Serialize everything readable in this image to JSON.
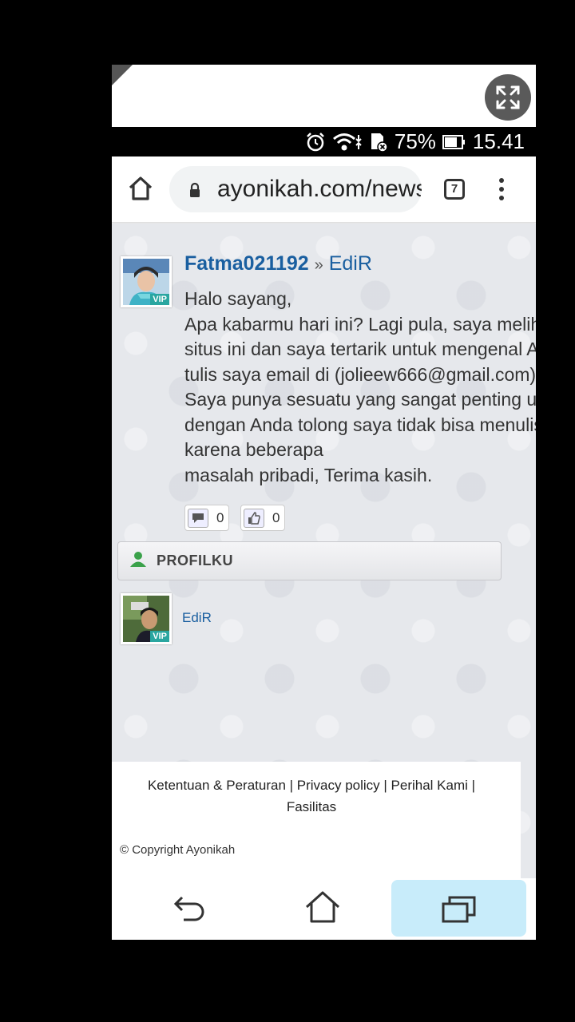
{
  "statusbar": {
    "battery": "75%",
    "time": "15.41"
  },
  "browser": {
    "url": "ayonikah.com/news",
    "tab_count": "7"
  },
  "post": {
    "author": "Fatma021192",
    "separator": "»",
    "recipient": "EdiR",
    "avatar_badge": "VIP",
    "lines": [
      "Halo sayang,",
      "Apa kabarmu hari ini? Lagi pula, saya melihat",
      "situs ini dan saya tertarik untuk mengenal Anda",
      "tulis saya email di (jolieew666@gmail.com)",
      "Saya punya sesuatu yang sangat penting untuk",
      "dengan Anda tolong saya tidak bisa menulis di sini",
      "karena beberapa",
      "masalah pribadi, Terima kasih."
    ],
    "comment_count": "0",
    "like_count": "0"
  },
  "profile": {
    "header": "PROFILKU",
    "name": "EdiR",
    "avatar_badge": "VIP"
  },
  "footer": {
    "links_line1": "Ketentuan & Peraturan | Privacy policy | Perihal Kami |",
    "links_line2": "Fasilitas",
    "copyright": "© Copyright Ayonikah"
  }
}
